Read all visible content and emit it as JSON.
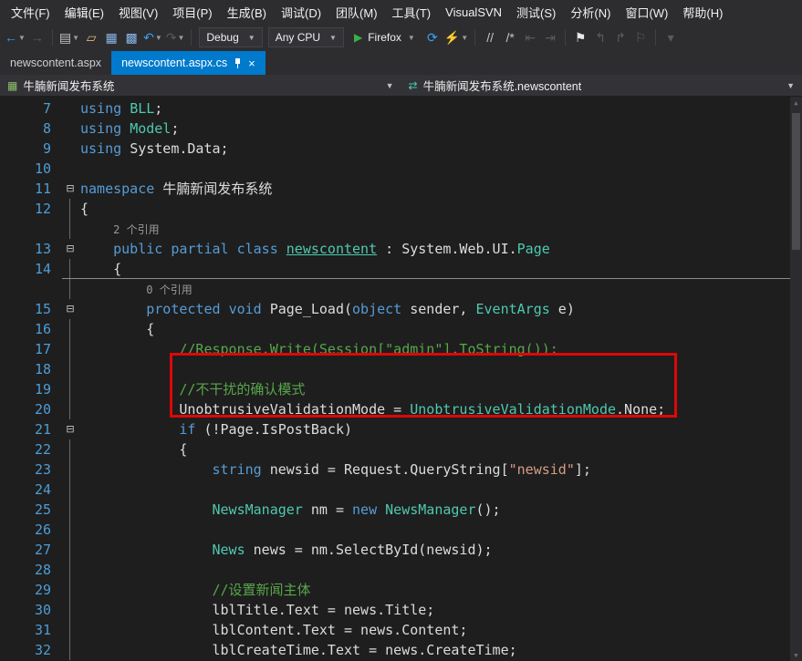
{
  "colors": {
    "bg-chrome": "#2d2d30",
    "bg-editor": "#1e1e1e",
    "accent": "#007acc",
    "keyword": "#569cd6",
    "type": "#4ec9b0",
    "comment": "#57a64a",
    "string": "#d69d85",
    "plain": "#dcdcdc",
    "linenum": "#4d9dd6",
    "codelens": "#9a9a9a",
    "annotation": "#dd0808"
  },
  "menu": {
    "items": [
      "文件(F)",
      "编辑(E)",
      "视图(V)",
      "项目(P)",
      "生成(B)",
      "调试(D)",
      "团队(M)",
      "工具(T)",
      "VisualSVN",
      "测试(S)",
      "分析(N)",
      "窗口(W)",
      "帮助(H)"
    ]
  },
  "toolbar": {
    "items": [
      {
        "type": "icon",
        "name": "navigate-backward-button",
        "glyph": "←",
        "color": "#3aa0f0",
        "caret": true
      },
      {
        "type": "icon",
        "name": "navigate-forward-button",
        "glyph": "→",
        "dim": true
      },
      {
        "type": "sep"
      },
      {
        "type": "icon",
        "name": "new-file-button",
        "glyph": "▤",
        "color": "#c5c5c5",
        "caret": true
      },
      {
        "type": "icon",
        "name": "open-file-button",
        "glyph": "▱",
        "color": "#dcb67a"
      },
      {
        "type": "icon",
        "name": "save-button",
        "glyph": "▦",
        "color": "#8ab4e8"
      },
      {
        "type": "icon",
        "name": "save-all-button",
        "glyph": "▩",
        "color": "#8ab4e8"
      },
      {
        "type": "icon",
        "name": "undo-button",
        "glyph": "↶",
        "color": "#3aa0f0",
        "caret": true
      },
      {
        "type": "icon",
        "name": "redo-button",
        "glyph": "↷",
        "dim": true,
        "caret": true
      },
      {
        "type": "sep"
      },
      {
        "type": "select",
        "name": "solution-configuration-select",
        "value": "Debug"
      },
      {
        "type": "select",
        "name": "solution-platform-select",
        "value": "Any CPU"
      },
      {
        "type": "run",
        "name": "start-debugging-button",
        "label": "Firefox"
      },
      {
        "type": "icon",
        "name": "refresh-browser-button",
        "glyph": "⟳",
        "color": "#3aa0f0"
      },
      {
        "type": "icon",
        "name": "browser-link-button",
        "glyph": "⚡",
        "color": "#c5c5c5",
        "caret": true
      },
      {
        "type": "sep"
      },
      {
        "type": "icon",
        "name": "comment-selection-button",
        "glyph": "//",
        "color": "#c5c5c5"
      },
      {
        "type": "icon",
        "name": "uncomment-selection-button",
        "glyph": "/*",
        "color": "#c5c5c5"
      },
      {
        "type": "icon",
        "name": "decrease-indent-button",
        "glyph": "⇤",
        "dim": true
      },
      {
        "type": "icon",
        "name": "increase-indent-button",
        "glyph": "⇥",
        "dim": true
      },
      {
        "type": "sep"
      },
      {
        "type": "icon",
        "name": "toggle-bookmark-button",
        "glyph": "⚑",
        "color": "#e8e8e8"
      },
      {
        "type": "icon",
        "name": "previous-bookmark-button",
        "glyph": "↰",
        "dim": true
      },
      {
        "type": "icon",
        "name": "next-bookmark-button",
        "glyph": "↱",
        "dim": true
      },
      {
        "type": "icon",
        "name": "clear-bookmarks-button",
        "glyph": "⚐",
        "dim": true
      },
      {
        "type": "sep"
      },
      {
        "type": "icon",
        "name": "toolbar-options-button",
        "glyph": "▾",
        "dim": true
      }
    ]
  },
  "tabs": [
    {
      "label": "newscontent.aspx",
      "active": false
    },
    {
      "label": "newscontent.aspx.cs",
      "active": true
    }
  ],
  "navbar": {
    "project": "牛腩新闻发布系统",
    "type": "牛腩新闻发布系统.newscontent"
  },
  "editor": {
    "lines": [
      {
        "num": "7",
        "outline": "",
        "tokens": [
          [
            "kw",
            "using"
          ],
          [
            "pl",
            " "
          ],
          [
            "ty",
            "BLL"
          ],
          [
            "pl",
            ";"
          ]
        ]
      },
      {
        "num": "8",
        "outline": "",
        "tokens": [
          [
            "kw",
            "using"
          ],
          [
            "pl",
            " "
          ],
          [
            "ty",
            "Model"
          ],
          [
            "pl",
            ";"
          ]
        ]
      },
      {
        "num": "9",
        "outline": "",
        "tokens": [
          [
            "kw",
            "using"
          ],
          [
            "pl",
            " "
          ],
          [
            "pl",
            "System.Data"
          ],
          [
            "pl",
            ";"
          ]
        ]
      },
      {
        "num": "10",
        "outline": "",
        "tokens": []
      },
      {
        "num": "11",
        "outline": "fold",
        "tokens": [
          [
            "kw",
            "namespace"
          ],
          [
            "pl",
            " 牛腩新闻发布系统"
          ]
        ]
      },
      {
        "num": "12",
        "outline": "line",
        "tokens": [
          [
            "pl",
            "{"
          ]
        ]
      },
      {
        "num": "",
        "codelens": true,
        "outline": "line",
        "tokens": [
          [
            "pl",
            "    "
          ],
          [
            "cl",
            "2 个引用"
          ]
        ]
      },
      {
        "num": "13",
        "outline": "fold",
        "tokens": [
          [
            "pl",
            "    "
          ],
          [
            "kw",
            "public"
          ],
          [
            "pl",
            " "
          ],
          [
            "kw",
            "partial"
          ],
          [
            "pl",
            " "
          ],
          [
            "kw",
            "class"
          ],
          [
            "pl",
            " "
          ],
          [
            "tyu",
            "newscontent"
          ],
          [
            "pl",
            " : System.Web.UI."
          ],
          [
            "ty",
            "Page"
          ]
        ]
      },
      {
        "num": "14",
        "outline": "line",
        "sep": true,
        "tokens": [
          [
            "pl",
            "    {"
          ]
        ]
      },
      {
        "num": "",
        "codelens": true,
        "outline": "line",
        "tokens": [
          [
            "pl",
            "        "
          ],
          [
            "cl",
            "0 个引用"
          ]
        ]
      },
      {
        "num": "15",
        "outline": "fold",
        "tokens": [
          [
            "pl",
            "        "
          ],
          [
            "kw",
            "protected"
          ],
          [
            "pl",
            " "
          ],
          [
            "kw",
            "void"
          ],
          [
            "pl",
            " Page_Load("
          ],
          [
            "kw",
            "object"
          ],
          [
            "pl",
            " sender, "
          ],
          [
            "ty",
            "EventArgs"
          ],
          [
            "pl",
            " e)"
          ]
        ]
      },
      {
        "num": "16",
        "outline": "line",
        "tokens": [
          [
            "pl",
            "        {"
          ]
        ]
      },
      {
        "num": "17",
        "outline": "line",
        "tokens": [
          [
            "pl",
            "            "
          ],
          [
            "cm",
            "//Response.Write(Session[\"admin\"].ToString());"
          ]
        ]
      },
      {
        "num": "18",
        "outline": "line",
        "tokens": []
      },
      {
        "num": "19",
        "outline": "line",
        "tokens": [
          [
            "pl",
            "            "
          ],
          [
            "cm",
            "//不干扰的确认模式"
          ]
        ]
      },
      {
        "num": "20",
        "outline": "line",
        "tokens": [
          [
            "pl",
            "            UnobtrusiveValidationMode = "
          ],
          [
            "ty",
            "UnobtrusiveValidationMode"
          ],
          [
            "pl",
            ".None;"
          ]
        ]
      },
      {
        "num": "21",
        "outline": "fold",
        "tokens": [
          [
            "pl",
            "            "
          ],
          [
            "kw",
            "if"
          ],
          [
            "pl",
            " (!Page.IsPostBack)"
          ]
        ]
      },
      {
        "num": "22",
        "outline": "line",
        "tokens": [
          [
            "pl",
            "            {"
          ]
        ]
      },
      {
        "num": "23",
        "outline": "line",
        "tokens": [
          [
            "pl",
            "                "
          ],
          [
            "kw",
            "string"
          ],
          [
            "pl",
            " newsid = Request.QueryString["
          ],
          [
            "st",
            "\"newsid\""
          ],
          [
            "pl",
            "];"
          ]
        ]
      },
      {
        "num": "24",
        "outline": "line",
        "tokens": []
      },
      {
        "num": "25",
        "outline": "line",
        "tokens": [
          [
            "pl",
            "                "
          ],
          [
            "ty",
            "NewsManager"
          ],
          [
            "pl",
            " nm = "
          ],
          [
            "kw",
            "new"
          ],
          [
            "pl",
            " "
          ],
          [
            "ty",
            "NewsManager"
          ],
          [
            "pl",
            "();"
          ]
        ]
      },
      {
        "num": "26",
        "outline": "line",
        "tokens": []
      },
      {
        "num": "27",
        "outline": "line",
        "tokens": [
          [
            "pl",
            "                "
          ],
          [
            "ty",
            "News"
          ],
          [
            "pl",
            " news = nm.SelectById(newsid);"
          ]
        ]
      },
      {
        "num": "28",
        "outline": "line",
        "tokens": []
      },
      {
        "num": "29",
        "outline": "line",
        "tokens": [
          [
            "pl",
            "                "
          ],
          [
            "cm",
            "//设置新闻主体"
          ]
        ]
      },
      {
        "num": "30",
        "outline": "line",
        "tokens": [
          [
            "pl",
            "                lblTitle.Text = news.Title;"
          ]
        ]
      },
      {
        "num": "31",
        "outline": "line",
        "tokens": [
          [
            "pl",
            "                lblContent.Text = news.Content;"
          ]
        ]
      },
      {
        "num": "32",
        "outline": "line",
        "tokens": [
          [
            "pl",
            "                lblCreateTime.Text = news.CreateTime;"
          ]
        ]
      }
    ]
  }
}
